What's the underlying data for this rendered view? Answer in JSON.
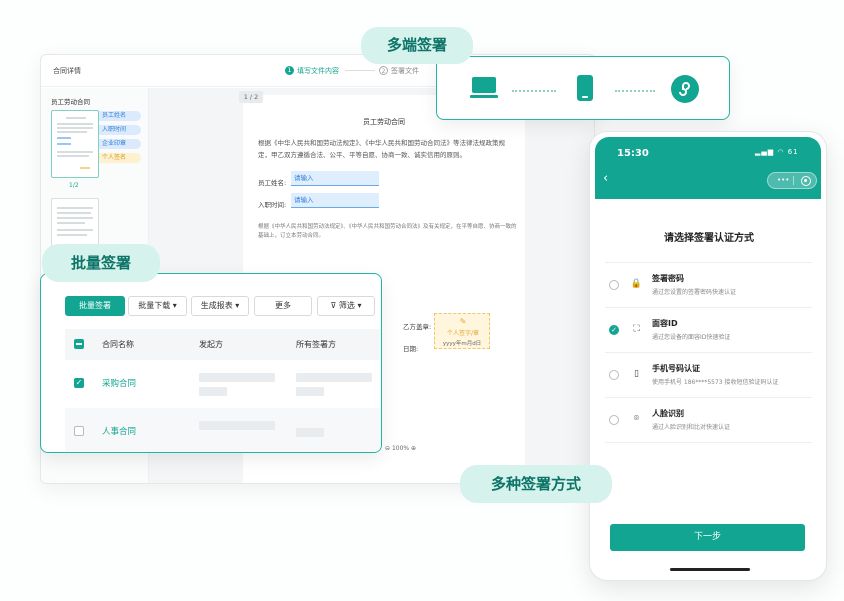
{
  "desktop": {
    "title": "合同详情",
    "steps": [
      {
        "num": "1",
        "label": "填写文件内容"
      },
      {
        "num": "2",
        "label": "签署文件"
      }
    ],
    "doc_list_title": "员工劳动合同",
    "page_indicator": "1/2",
    "field_chips": [
      "员工姓名",
      "入职时间",
      "企业印章",
      "个人签名"
    ],
    "page_badge": "1 / 2",
    "paper": {
      "title": "员工劳动合同",
      "para1": "根据《中华人民共和国劳动法规定》、《中华人民共和国劳动合同法》等法律法规政策规定，甲乙双方遵循合法、公平、平等自愿、协商一致、诚实信用的原则。",
      "name_label": "员工姓名:",
      "name_placeholder": "请输入",
      "date_label": "入职时间:",
      "date_placeholder": "请输入",
      "para2": "根据《中华人民共和国劳动法规定》、《中华人民共和国劳动合同法》及有关规定，在平等自愿、协商一致的基础上，订立本劳动合同。",
      "seal_label": "乙方盖章:",
      "seal_icon": "pen-icon",
      "seal_text": "个人签字/章",
      "date_sign_label": "日期:",
      "date_sign_text": "yyyy年m月d日"
    },
    "zoom": "100%"
  },
  "batch": {
    "label": "批量签署",
    "toolbar": [
      "批量签署",
      "批量下载 ▾",
      "生成报表 ▾",
      "更多",
      "筛选 ▾"
    ],
    "columns": [
      "合同名称",
      "发起方",
      "所有签署方"
    ],
    "rows": [
      {
        "name": "采购合同",
        "checked": true
      },
      {
        "name": "人事合同",
        "checked": false
      }
    ]
  },
  "multi_device": {
    "label": "多端签署",
    "devices": [
      "laptop-icon",
      "phone-icon",
      "mini-program-icon"
    ]
  },
  "phone": {
    "time": "15:30",
    "status": "▂▄▆ ◠ 61",
    "capsule_more": "•••",
    "title": "请选择签署认证方式",
    "options": [
      {
        "icon": "lock-icon",
        "glyph": "🔒",
        "title": "签署密码",
        "desc": "通过您设置的签署密码快速认证",
        "selected": false
      },
      {
        "icon": "face-id-icon",
        "glyph": "⛶",
        "title": "面容ID",
        "desc": "通过您设备的面容ID快速验证",
        "selected": true
      },
      {
        "icon": "phone-sms-icon",
        "glyph": "▯",
        "title": "手机号码认证",
        "desc": "使用手机号 186****5573 接收短信验证码认证",
        "selected": false
      },
      {
        "icon": "face-scan-icon",
        "glyph": "⌾",
        "title": "人脸识别",
        "desc": "通过人脸识别和比对快速认证",
        "selected": false
      }
    ],
    "next_button": "下一步"
  },
  "ways_label": "多种签署方式",
  "colors": {
    "accent": "#12a592",
    "accent_light": "#d5f2ed"
  }
}
